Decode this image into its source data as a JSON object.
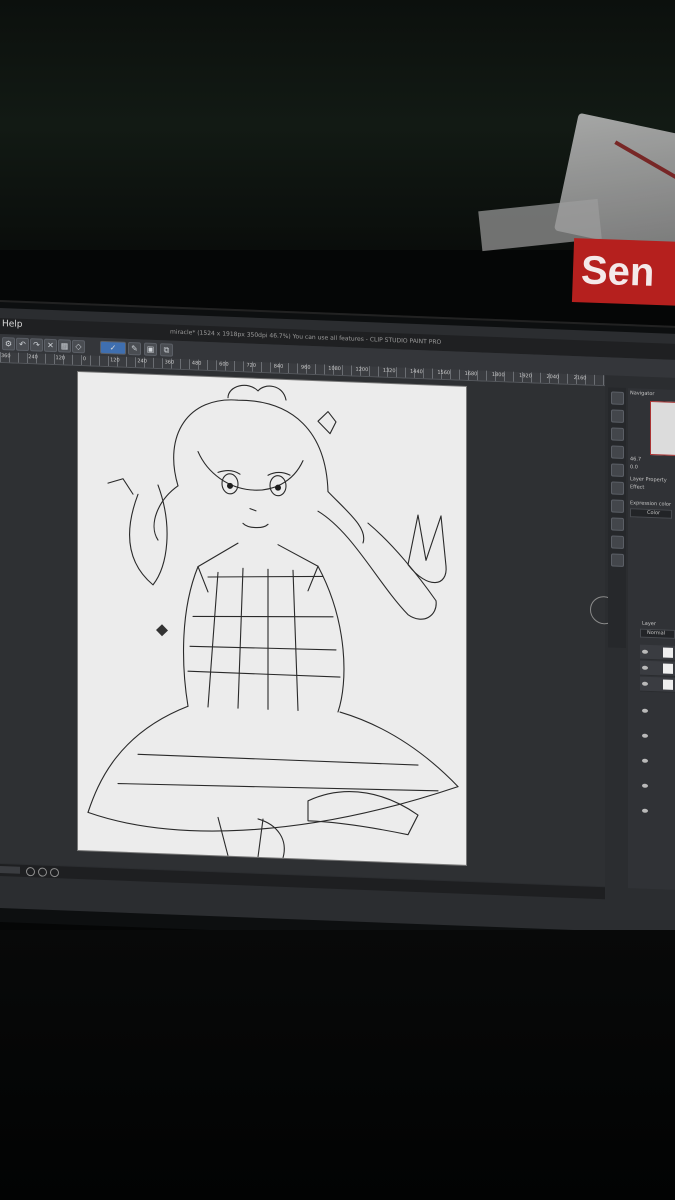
{
  "app": {
    "menu_help": "Help",
    "window_title": "miracle* (1524 x 1918px 350dpi 46.7%)  You can use all features - CLIP STUDIO PAINT PRO"
  },
  "ruler": {
    "ticks": [
      "360",
      "240",
      "120",
      "0",
      "120",
      "240",
      "360",
      "480",
      "600",
      "720",
      "840",
      "960",
      "1080",
      "1200",
      "1320",
      "1440",
      "1560",
      "1680",
      "1800",
      "1920",
      "2040",
      "2160"
    ]
  },
  "status": {
    "zoom": ""
  },
  "right_panel": {
    "navigator_label": "Navigator",
    "zoom_value": "46.7",
    "angle_value": "0.0",
    "layer_property_label": "Layer Property",
    "effect_label": "Effect",
    "expression_color_label": "Expression color",
    "color_value": "Color",
    "layer_tab_label": "Layer",
    "normal_label": "Normal"
  },
  "sticker": {
    "text": "Sen"
  },
  "colors": {
    "accent": "#3f6fb0",
    "sticker": "#b5201e",
    "canvas": "#ececec",
    "ui_dark": "#2b2d30"
  },
  "icons": {
    "toolbar": [
      "gear-icon",
      "undo-icon",
      "redo-icon",
      "clear-icon",
      "fill-icon",
      "transform-icon",
      "select-icon",
      "pen-icon",
      "save-icon",
      "export-icon"
    ],
    "strip": [
      "navigator-icon",
      "subview-icon",
      "property-icon",
      "brush-size-icon",
      "color-wheel-icon",
      "color-set-icon",
      "intermediate-icon",
      "history-icon",
      "layer-icon",
      "material-icon"
    ]
  }
}
